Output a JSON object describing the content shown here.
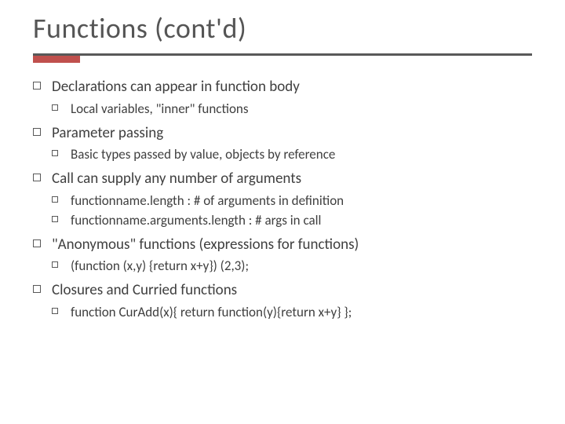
{
  "title": "Functions (cont'd)",
  "items": [
    {
      "text": "Declarations can appear in function body",
      "sub": [
        {
          "text": "Local variables, \"inner\" functions"
        }
      ]
    },
    {
      "text": "Parameter passing",
      "sub": [
        {
          "text": "Basic types passed by value, objects by reference"
        }
      ]
    },
    {
      "text": "Call can supply any number of arguments",
      "sub": [
        {
          "text": "functionname.length : # of arguments in definition"
        },
        {
          "text": "functionname.arguments.length : # args in call"
        }
      ]
    },
    {
      "text": "\"Anonymous\" functions (expressions for functions)",
      "sub": [
        {
          "text": "(function (x,y) {return x+y}) (2,3);"
        }
      ]
    },
    {
      "text": "Closures and Curried functions",
      "sub": [
        {
          "text": "function CurAdd(x){ return function(y){return x+y} };"
        }
      ]
    }
  ]
}
